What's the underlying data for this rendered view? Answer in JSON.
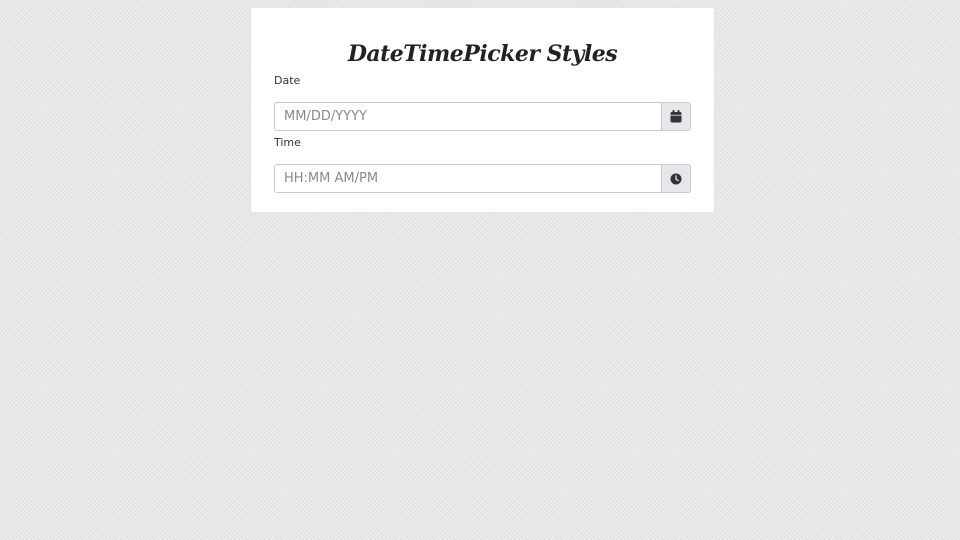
{
  "card": {
    "title": "DateTimePicker Styles"
  },
  "date_field": {
    "label": "Date",
    "placeholder": "MM/DD/YYYY",
    "value": "",
    "icon": "calendar-icon"
  },
  "time_field": {
    "label": "Time",
    "placeholder": "HH:MM AM/PM",
    "value": "",
    "icon": "clock-icon"
  },
  "colors": {
    "page_background": "#e7e7e7",
    "card_background": "#ffffff",
    "input_border": "#c9c9d6",
    "addon_background": "#e6e6eb",
    "icon_color": "#333333"
  }
}
